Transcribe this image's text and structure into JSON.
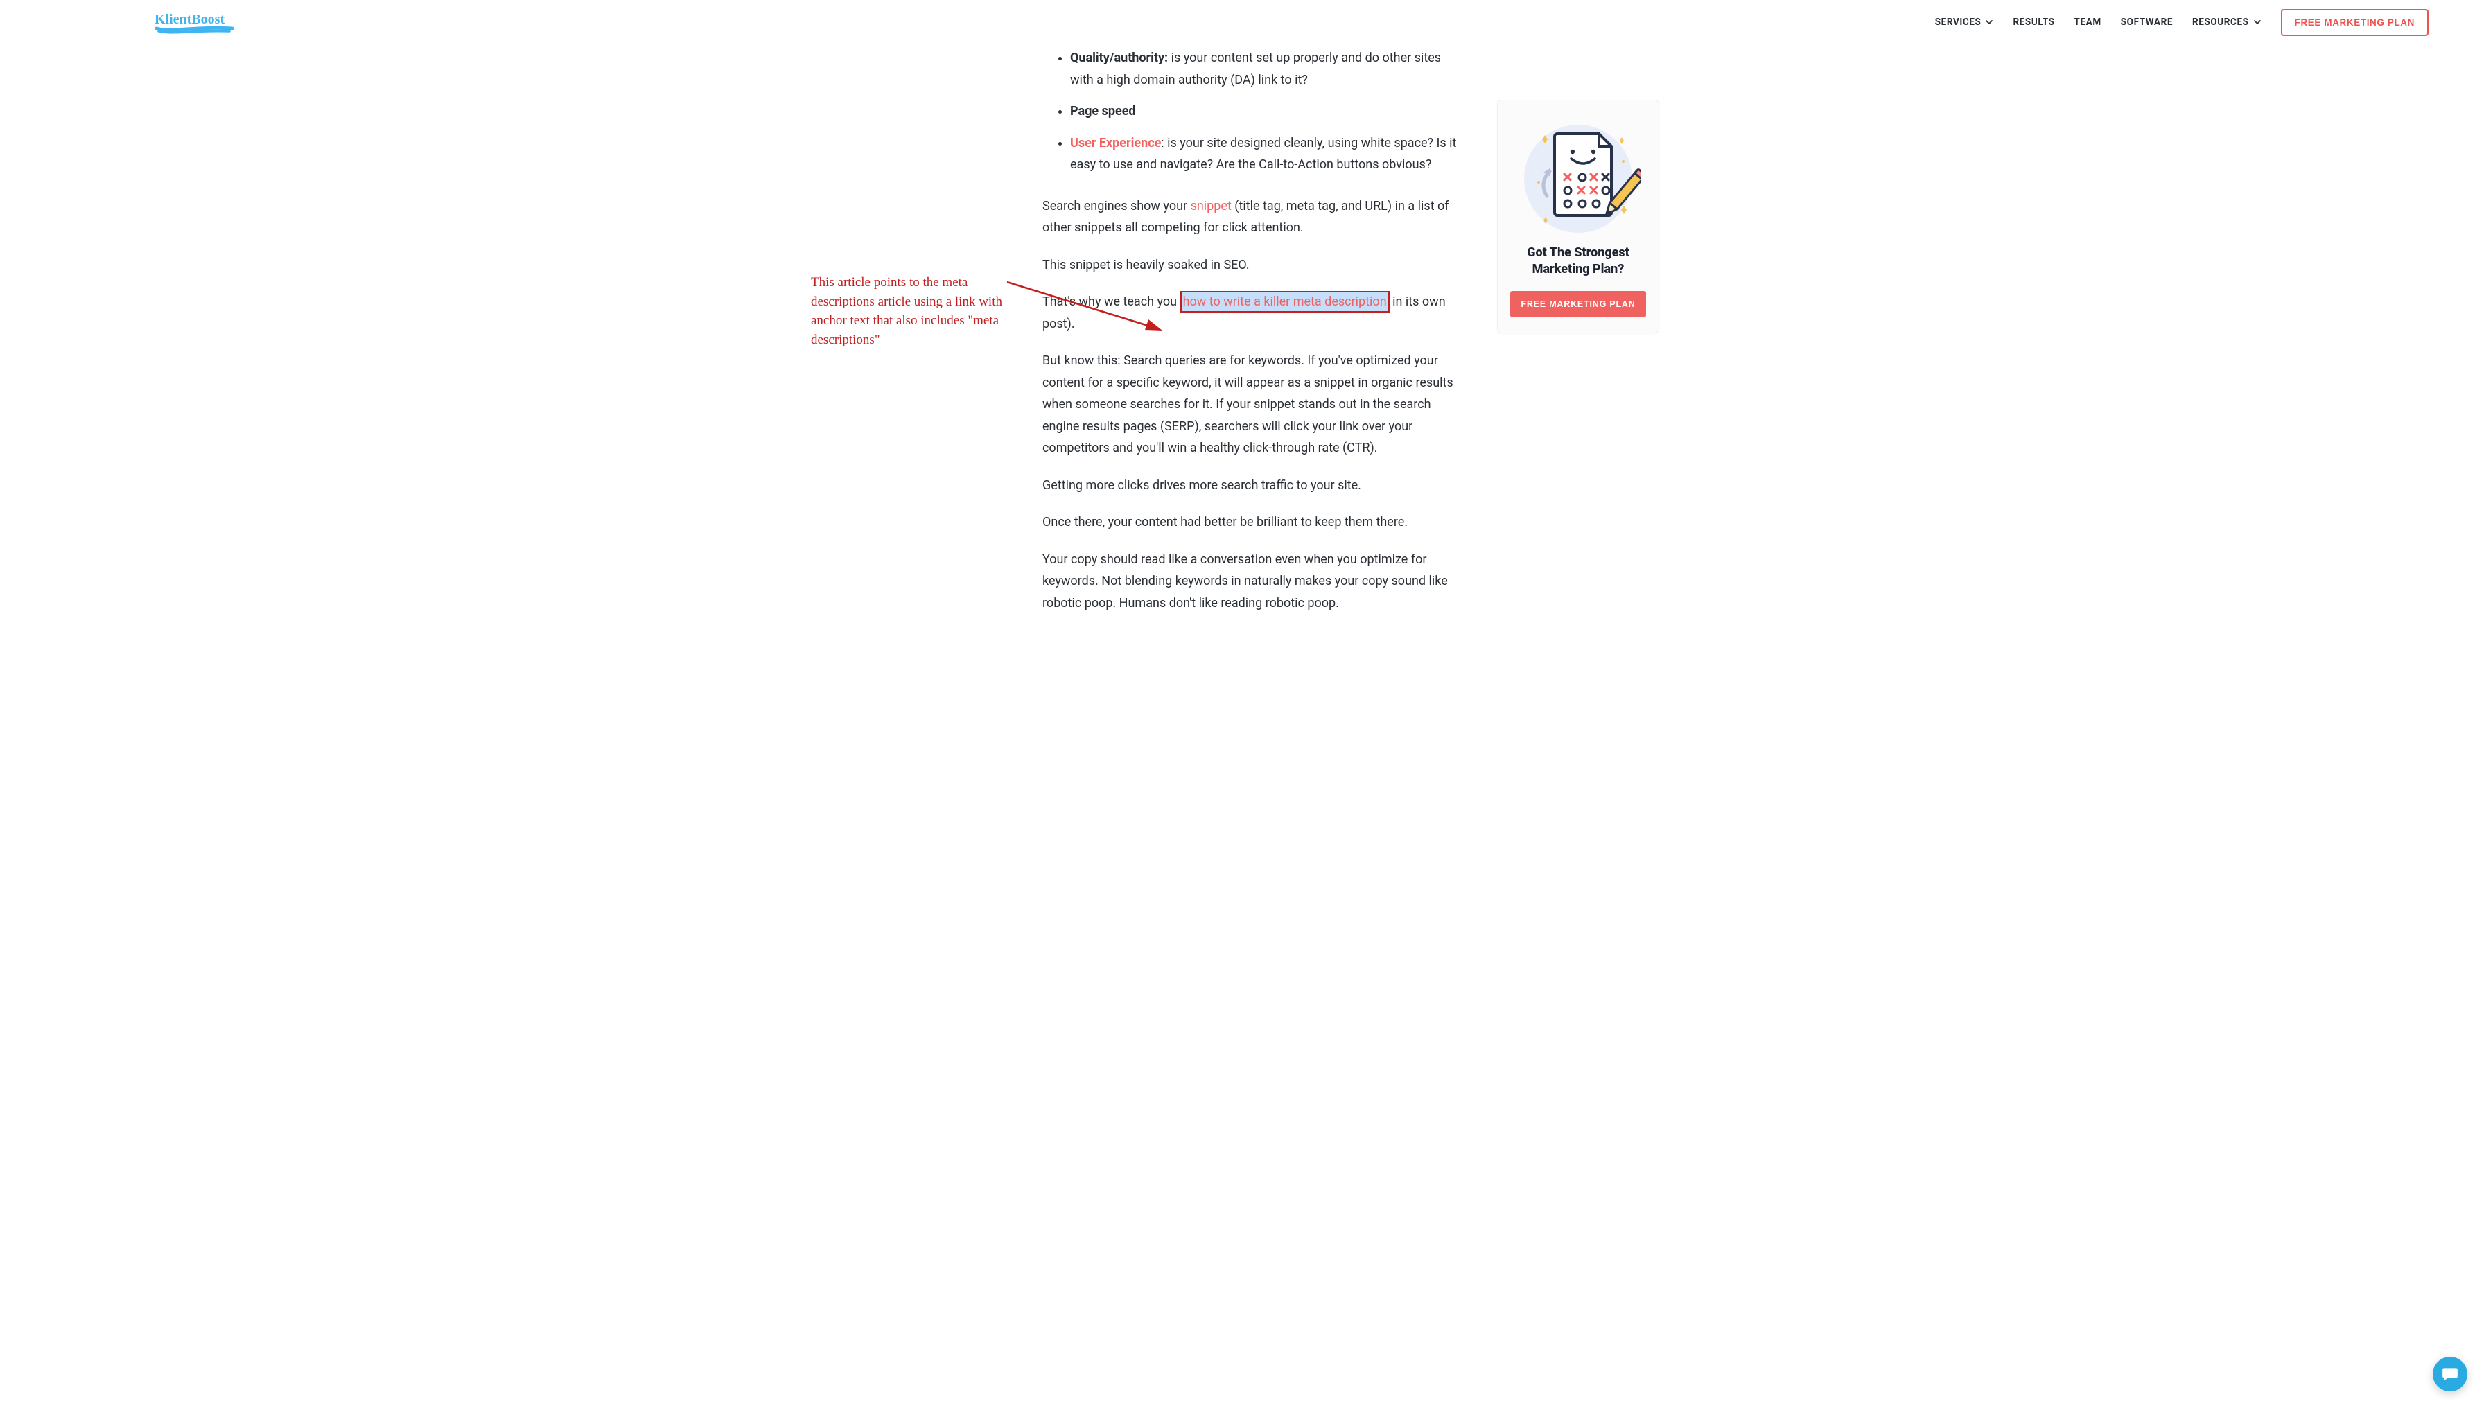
{
  "nav": {
    "items": [
      {
        "label": "SERVICES",
        "dropdown": true
      },
      {
        "label": "RESULTS",
        "dropdown": false
      },
      {
        "label": "TEAM",
        "dropdown": false
      },
      {
        "label": "SOFTWARE",
        "dropdown": false
      },
      {
        "label": "RESOURCES",
        "dropdown": true
      }
    ],
    "cta": "FREE MARKETING PLAN"
  },
  "article": {
    "bullets": {
      "quality_bold": "Quality/authority:",
      "quality_rest": " is your content set up properly and do other sites with a high domain authority (DA) link to it?",
      "page_speed_bold": "Page speed",
      "ux_link": "User Experience",
      "ux_rest": ": is your site designed cleanly, using white space? Is it easy to use and navigate? Are the Call-to-Action buttons obvious?"
    },
    "p1a": "Search engines show your ",
    "p1_link": "snippet",
    "p1b": " (title tag, meta tag, and URL) in a list of other snippets all competing for click attention.",
    "p2": "This snippet is heavily soaked in SEO.",
    "p3a": "That's why we teach you ",
    "p3_link": "how to write a killer meta description",
    "p3b": " in its own post).",
    "p4": "But know this: Search queries are for keywords. If you've optimized your content for a specific keyword, it will appear as a snippet in organic results when someone searches for it. If your snippet stands out in the search engine results pages (SERP), searchers will click your link over your competitors and you'll win a healthy click-through rate (CTR).",
    "p5": "Getting more clicks drives more search traffic to your site.",
    "p6": "Once there, your content had better be brilliant to keep them there.",
    "p7": "Your copy should read like a conversation even when you optimize for keywords. Not blending keywords in naturally makes your copy sound like robotic poop. Humans don't like reading robotic poop."
  },
  "annotation": {
    "text": "This article points to the meta descriptions article using a link with anchor text that also includes \"meta descriptions\""
  },
  "sidebar": {
    "title": "Got The Strongest Marketing Plan?",
    "cta": "FREE MARKETING PLAN"
  }
}
